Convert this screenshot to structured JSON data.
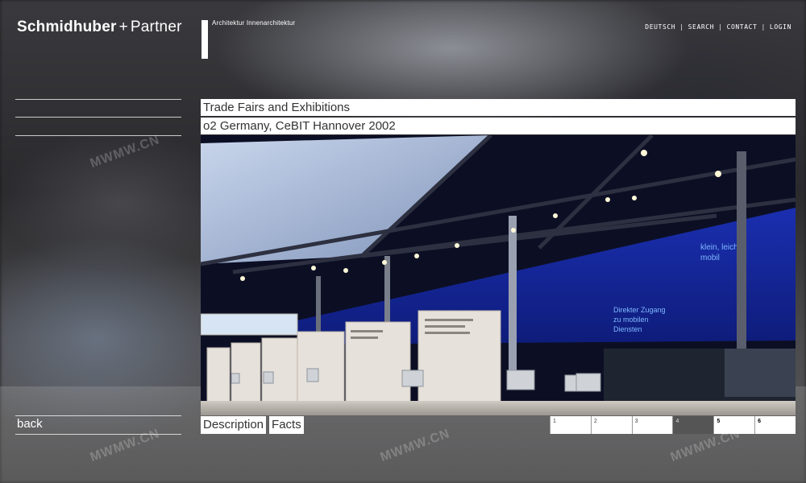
{
  "brand": {
    "name_bold": "Schmidhuber",
    "plus": "+",
    "name_light": "Partner",
    "tagline": "Architektur  Innenarchitektur"
  },
  "topnav": {
    "items": [
      "DEUTSCH",
      "SEARCH",
      "CONTACT",
      "LOGIN"
    ],
    "separator": "|"
  },
  "content": {
    "category": "Trade Fairs and Exhibitions",
    "project": "o2 Germany, CeBIT Hannover 2002"
  },
  "photo": {
    "banner_text_1": "klein, leicht, mobil",
    "banner_text_2": "Direkter Zugang zu mobilen Diensten"
  },
  "sidebar": {
    "back_label": "back"
  },
  "tabs": {
    "description": "Description",
    "facts": "Facts"
  },
  "pager": {
    "pages": [
      "1",
      "2",
      "3",
      "4",
      "5",
      "6"
    ],
    "active_page": "4"
  },
  "watermark": "MWMW.CN",
  "colors": {
    "banner_blue": "#1a2fb0",
    "active_page": "#555555"
  }
}
